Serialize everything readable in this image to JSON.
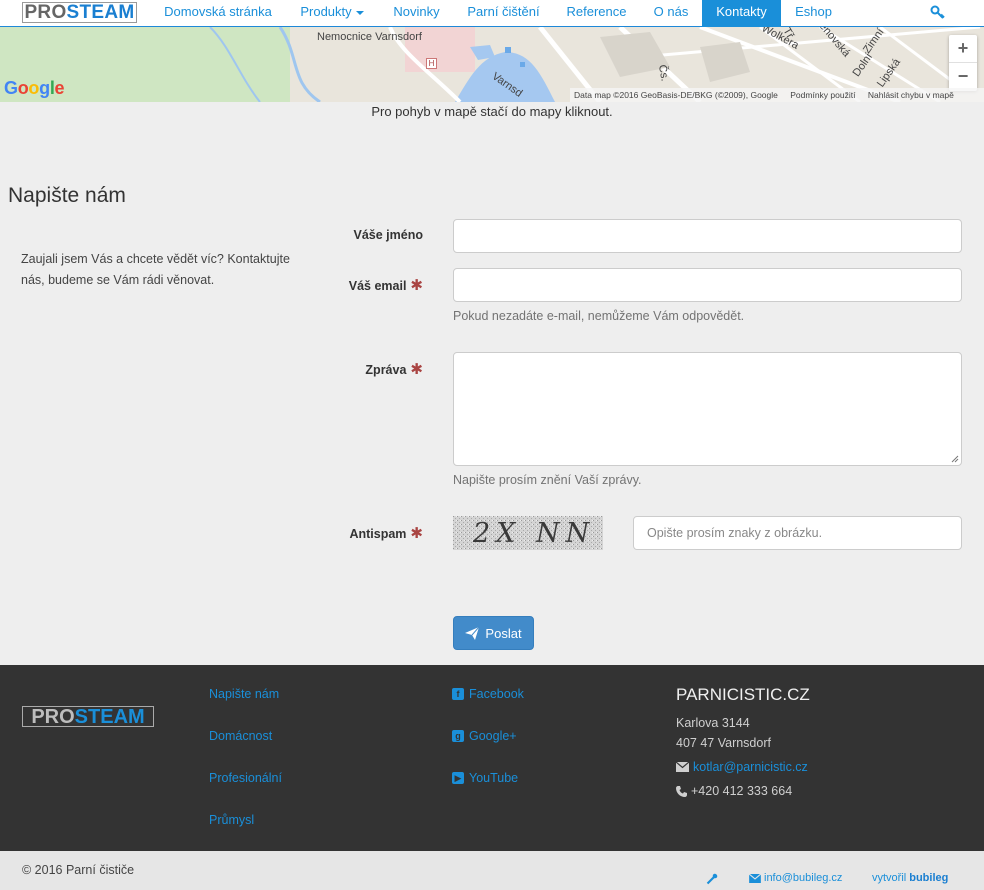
{
  "brand": {
    "pro": "PRO",
    "steam": "STEAM"
  },
  "nav": {
    "home": "Domovská stránka",
    "products": "Produkty",
    "news": "Novinky",
    "steam_cleaning": "Parní čištění",
    "references": "Reference",
    "about": "O nás",
    "contacts": "Kontakty",
    "eshop": "Eshop"
  },
  "map": {
    "hospital_label": "Nemocnice Varnsdorf",
    "hospital_badge": "H",
    "street_1": "Varnsd",
    "street_2": "Wolkera",
    "street_3": "Šenovská",
    "street_4": "Zimní",
    "street_5": "Dolní",
    "street_6": "Lipská",
    "street_7": "Čs.",
    "street_8": "Tř",
    "google": "Google",
    "zoom_in": "+",
    "zoom_out": "−",
    "attribution": "Data map ©2016 GeoBasis-DE/BKG (©2009), Google",
    "terms": "Podmínky použití",
    "report": "Nahlásit chybu v mapě",
    "hint": "Pro pohyb v mapě stačí do mapy kliknout."
  },
  "form": {
    "title": "Napište nám",
    "intro": "Zaujali jsem Vás a chcete vědět víc? Kontaktujte nás, budeme se Vám rádi věnovat.",
    "name_label": "Váše jméno",
    "email_label": "Váš email",
    "email_help": "Pokud nezadáte e-mail, nemůžeme Vám odpovědět.",
    "message_label": "Zpráva",
    "message_help": "Napište prosím znění Vaší zprávy.",
    "antispam_label": "Antispam",
    "captcha_text": "2X NN",
    "antispam_placeholder": "Opište prosím znaky z obrázku.",
    "required_mark": "✱",
    "send_label": "Poslat"
  },
  "footer": {
    "links": [
      "Napište nám",
      "Domácnost",
      "Profesionální",
      "Průmysl"
    ],
    "social": [
      {
        "label": "Facebook",
        "icon": "facebook-icon"
      },
      {
        "label": "Google+",
        "icon": "google-plus-icon"
      },
      {
        "label": "YouTube",
        "icon": "youtube-icon"
      }
    ],
    "company": "PARNICISTIC.CZ",
    "street": "Karlova 3144",
    "city": "407 47 Varnsdorf",
    "email": "kotlar@parnicistic.cz",
    "phone": "+420 412 333 664"
  },
  "bottom": {
    "copyright": "© 2016 Parní čističe",
    "support_email": "info@bubileg.cz",
    "created_by_prefix": "vytvořil",
    "created_by_name": "bubileg"
  },
  "colors": {
    "accent": "#1a8fd9",
    "button": "#428bca",
    "footer_bg": "#333333",
    "page_bg": "#eeeeee",
    "required": "#a94442"
  }
}
